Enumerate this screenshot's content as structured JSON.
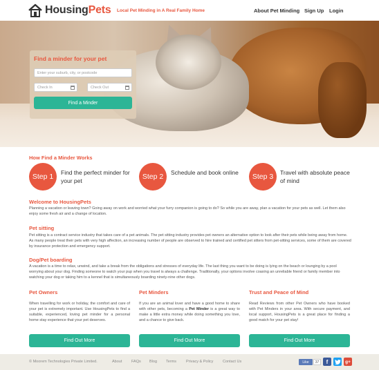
{
  "header": {
    "logo_part1": "Housing",
    "logo_part2": "Pets",
    "tagline": "Local Pet Minding in A Real Family Home",
    "nav": [
      "About Pet Minding",
      "Sign Up",
      "Login"
    ]
  },
  "search": {
    "title": "Find a minder for your pet",
    "location_placeholder": "Enter your suburb, city, or postcode",
    "checkin_placeholder": "Check In",
    "checkout_placeholder": "Check Out",
    "button": "Find a Minder"
  },
  "how": {
    "title": "How Find a Minder Works",
    "steps": [
      {
        "label": "Step 1",
        "text": "Find the perfect minder for your pet"
      },
      {
        "label": "Step 2",
        "text": "Schedule and book online"
      },
      {
        "label": "Step 3",
        "text": "Travel with absolute peace of mind"
      }
    ]
  },
  "welcome": {
    "title": "Welcome to HousingPets",
    "text": "Planning a vacation or leaving town? Going away on work and worried what your furry companion is going to do? So while you are away, plan a vacation for your pets as well. Let them also enjoy some fresh air and a change of location."
  },
  "petsitting": {
    "title": "Pet sitting",
    "text": "Pet sitting is a contract service industry that takes care of a pet animals. The pet sitting industry provides pet owners an alternative option to look after their pets while being away from home. As many people treat their pets with very high affection, an increasing number of people are observed to hire trained and certified pet sitters from pet-sitting services, some of them are covered by insurance protection and emergency support."
  },
  "boarding": {
    "title": "Dog/Pet boarding",
    "text": "A vacation is a time to relax, unwind, and take a break from the obligations and stresses of everyday life. The last thing you want to be doing is lying on the beach or lounging by a pool worrying about your dog. Finding someone to watch your pup when you travel is always a challenge. Traditionally, your options involve coaxing an unreliable friend or family member into watching your dog or taking him to a kennel that is simultaneously boarding ninety-nine other dogs."
  },
  "columns": [
    {
      "title": "Pet Owners",
      "text": "When travelling for work or holiday, the comfort and care of your pet is extremely important. Use HousingPets to find a suitable, experienced, loving pet minder for a personal home stay experience that your pet deserves.",
      "button": "Find Out More"
    },
    {
      "title": "Pet Minders",
      "text_before": "If you are an animal lover and have a good home to share with other pets, becoming a ",
      "text_bold": "Pet Minder",
      "text_after": " is a great way to make a little extra money while doing something you love, and a chance to give back.",
      "button": "Find Out More"
    },
    {
      "title": "Trust and Peace of Mind",
      "text": "Read Reviews from other Pet Owners who have booked with Pet Minders in your area. With secure payment, and local support, HousingPets is a great place for finding a good match for your pet stay!",
      "button": "Find Out More"
    }
  ],
  "footer": {
    "copyright": "© Moorem Technologies Private Limited.",
    "links": [
      "About",
      "FAQs",
      "Blog",
      "Terms",
      "Privacy & Policy",
      "Contact Us"
    ],
    "like_label": "Like",
    "like_count": "37",
    "social_icons": [
      "facebook-icon",
      "twitter-icon",
      "google-plus-icon"
    ]
  },
  "colors": {
    "brand_red": "#e8573f",
    "teal": "#2cb596",
    "facebook": "#3b5998",
    "twitter": "#1da1f2",
    "gplus": "#dd4b39"
  }
}
